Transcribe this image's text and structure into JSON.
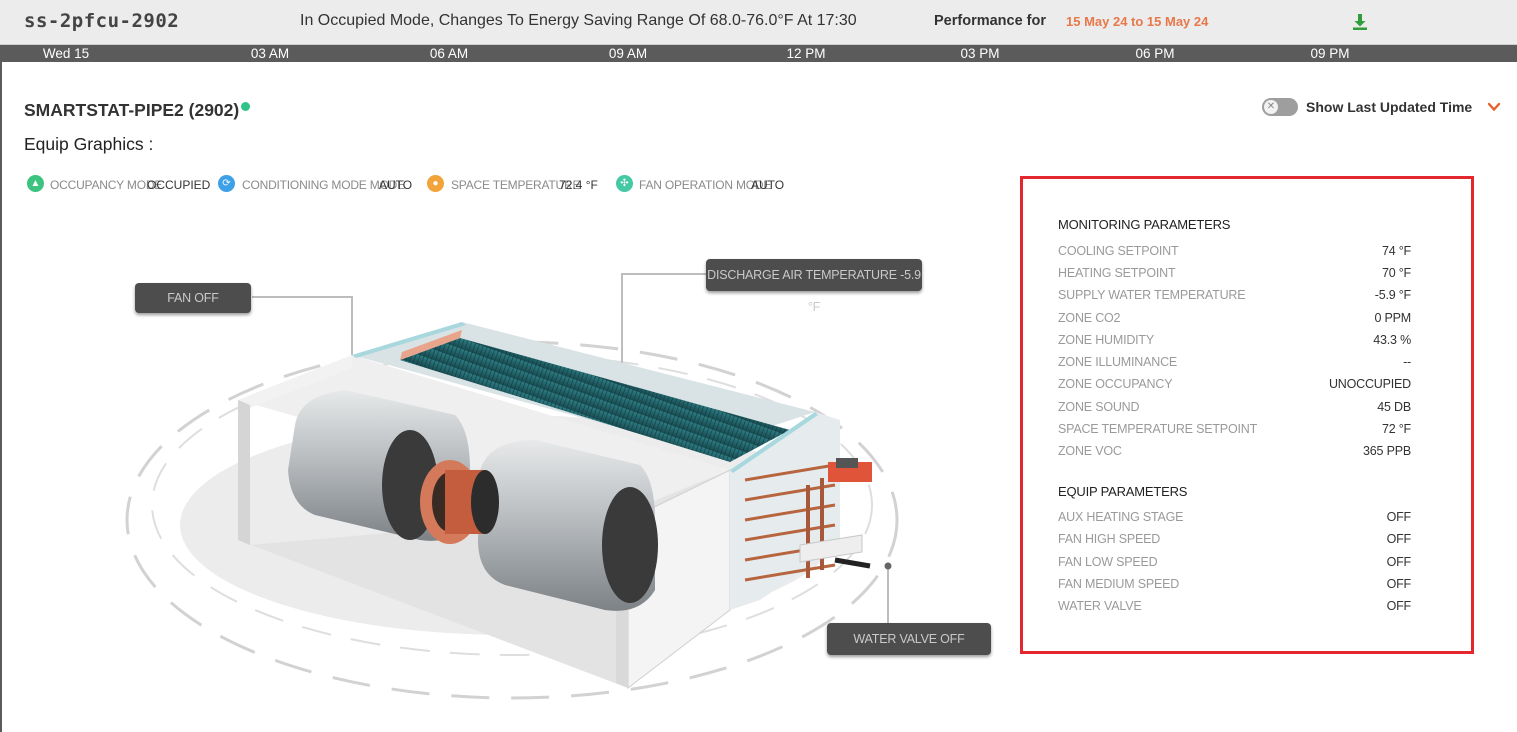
{
  "header": {
    "device_id": "ss-2pfcu-2902",
    "schedule_message": "In Occupied Mode, Changes To Energy Saving Range Of 68.0-76.0°F At 17:30",
    "performance_label": "Performance for",
    "performance_range": "15 May 24 to 15 May 24",
    "download_icon": "download-icon"
  },
  "timeline": [
    "Wed 15",
    "03 AM",
    "06 AM",
    "09 AM",
    "12 PM",
    "03 PM",
    "06 PM",
    "09 PM"
  ],
  "equipment": {
    "name": "SMARTSTAT-PIPE2 (2902)",
    "graphics_label": "Equip Graphics :",
    "toggle_label": "Show Last Updated Time",
    "toggle_on": false
  },
  "status_chips": [
    {
      "icon": "occupancy-icon",
      "color": "#3cc37f",
      "label": "OCCUPANCY MODE",
      "value": "OCCUPIED"
    },
    {
      "icon": "conditioning-icon",
      "color": "#3ea1e8",
      "label": "CONDITIONING MODE MODE",
      "value": "AUTO"
    },
    {
      "icon": "temperature-icon",
      "color": "#f2a33a",
      "label": "SPACE TEMPERATURE",
      "value": "72.4 °F"
    },
    {
      "icon": "fan-icon",
      "color": "#45c8a4",
      "label": "FAN OPERATION MODE",
      "value": "AUTO"
    }
  ],
  "callouts": {
    "fan": "FAN OFF",
    "discharge": "DISCHARGE AIR TEMPERATURE -5.9 °F",
    "water_valve": "WATER VALVE OFF"
  },
  "panel": {
    "monitoring_title": "MONITORING PARAMETERS",
    "monitoring": [
      {
        "label": "COOLING SETPOINT",
        "value": "74 °F"
      },
      {
        "label": "HEATING SETPOINT",
        "value": "70 °F"
      },
      {
        "label": "SUPPLY WATER TEMPERATURE",
        "value": "-5.9 °F"
      },
      {
        "label": "ZONE CO2",
        "value": "0 PPM"
      },
      {
        "label": "ZONE HUMIDITY",
        "value": "43.3 %"
      },
      {
        "label": "ZONE ILLUMINANCE",
        "value": "--"
      },
      {
        "label": "ZONE OCCUPANCY",
        "value": "UNOCCUPIED"
      },
      {
        "label": "ZONE SOUND",
        "value": "45 DB"
      },
      {
        "label": "SPACE TEMPERATURE SETPOINT",
        "value": "72 °F"
      },
      {
        "label": "ZONE VOC",
        "value": "365 PPB"
      }
    ],
    "equip_title": "EQUIP PARAMETERS",
    "equip": [
      {
        "label": "AUX HEATING STAGE",
        "value": "OFF"
      },
      {
        "label": "FAN HIGH SPEED",
        "value": "OFF"
      },
      {
        "label": "FAN LOW SPEED",
        "value": "OFF"
      },
      {
        "label": "FAN MEDIUM SPEED",
        "value": "OFF"
      },
      {
        "label": "WATER VALVE",
        "value": "OFF"
      }
    ]
  },
  "colors": {
    "accent_orange": "#e8784a",
    "status_green": "#2fc38a",
    "panel_border": "#e4262e",
    "coil_teal": "#1f5f66"
  }
}
